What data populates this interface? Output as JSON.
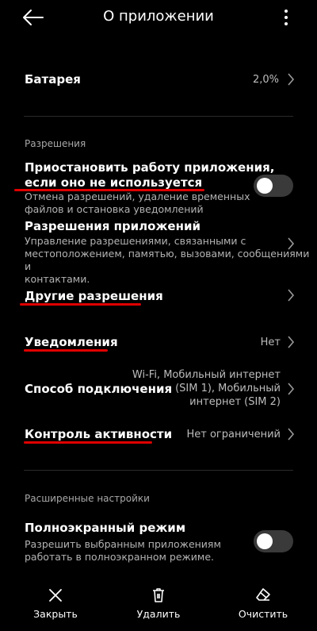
{
  "header": {
    "title": "О приложении",
    "back_icon": "arrow-left-icon",
    "menu_icon": "more-vertical-icon"
  },
  "battery": {
    "label": "Батарея",
    "value": "2,0%"
  },
  "permissions": {
    "section_title": "Разрешения",
    "pause_app": {
      "title_line1": "Приостановить работу приложения,",
      "title_line2": "если оно не используется",
      "subtitle_line1": "Отмена разрешений, удаление временных",
      "subtitle_line2": "файлов и остановка уведомлений",
      "enabled": false
    },
    "app_permissions": {
      "title": "Разрешения приложений",
      "subtitle_line1": "Управление разрешениями, связанными с",
      "subtitle_line2": "местоположением, памятью, вызовами, сообщениями и",
      "subtitle_line3": "контактами."
    },
    "other_permissions": {
      "title": "Другие разрешения"
    },
    "notifications": {
      "title": "Уведомления",
      "value": "Нет"
    },
    "connection": {
      "title": "Способ подключения",
      "value_line1": "Wi-Fi, Мобильный интернет",
      "value_line2": "(SIM 1), Мобильный",
      "value_line3": "интернет (SIM 2)"
    },
    "activity": {
      "title": "Контроль активности",
      "value": "Нет ограничений"
    }
  },
  "advanced": {
    "section_title": "Расширенные настройки",
    "fullscreen": {
      "title": "Полноэкранный режим",
      "subtitle_line1": "Разрешить выбранным приложениям",
      "subtitle_line2": "работать в полноэкранном режиме.",
      "enabled": false
    }
  },
  "bottom_bar": {
    "close_label": "Закрыть",
    "delete_label": "Удалить",
    "clear_label": "Очистить"
  },
  "colors": {
    "background": "#000000",
    "annotation": "#e00000",
    "toggle_track": "#3a3a3a"
  }
}
